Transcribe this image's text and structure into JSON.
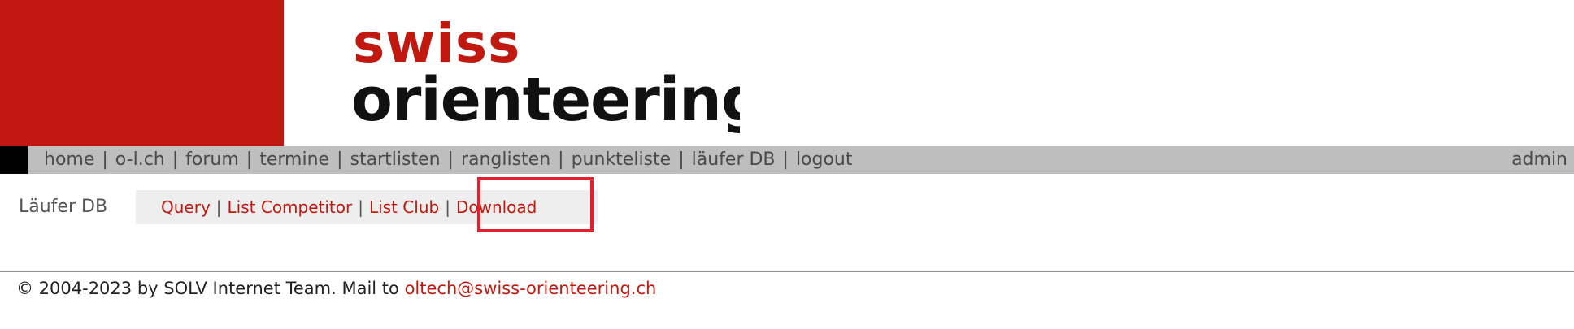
{
  "logo": {
    "line1": "swiss",
    "line2": "orienteering"
  },
  "nav": {
    "items": [
      {
        "label": "home"
      },
      {
        "label": "o-l.ch"
      },
      {
        "label": "forum"
      },
      {
        "label": "termine"
      },
      {
        "label": "startlisten"
      },
      {
        "label": "ranglisten"
      },
      {
        "label": "punkteliste"
      },
      {
        "label": "läufer DB"
      },
      {
        "label": "logout"
      }
    ],
    "separator": "|",
    "admin": "admin"
  },
  "section": {
    "title": "Läufer DB"
  },
  "subnav": {
    "items": [
      {
        "label": "Query"
      },
      {
        "label": "List Competitor"
      },
      {
        "label": "List Club"
      },
      {
        "label": "Download"
      }
    ],
    "separator": "|"
  },
  "footer": {
    "text": "© 2004-2023 by SOLV Internet Team. Mail to",
    "email": "oltech@swiss-orienteering.ch"
  },
  "colors": {
    "brand_red": "#c1190f",
    "nav_bg": "#bebebe",
    "highlight": "#e5202e"
  }
}
